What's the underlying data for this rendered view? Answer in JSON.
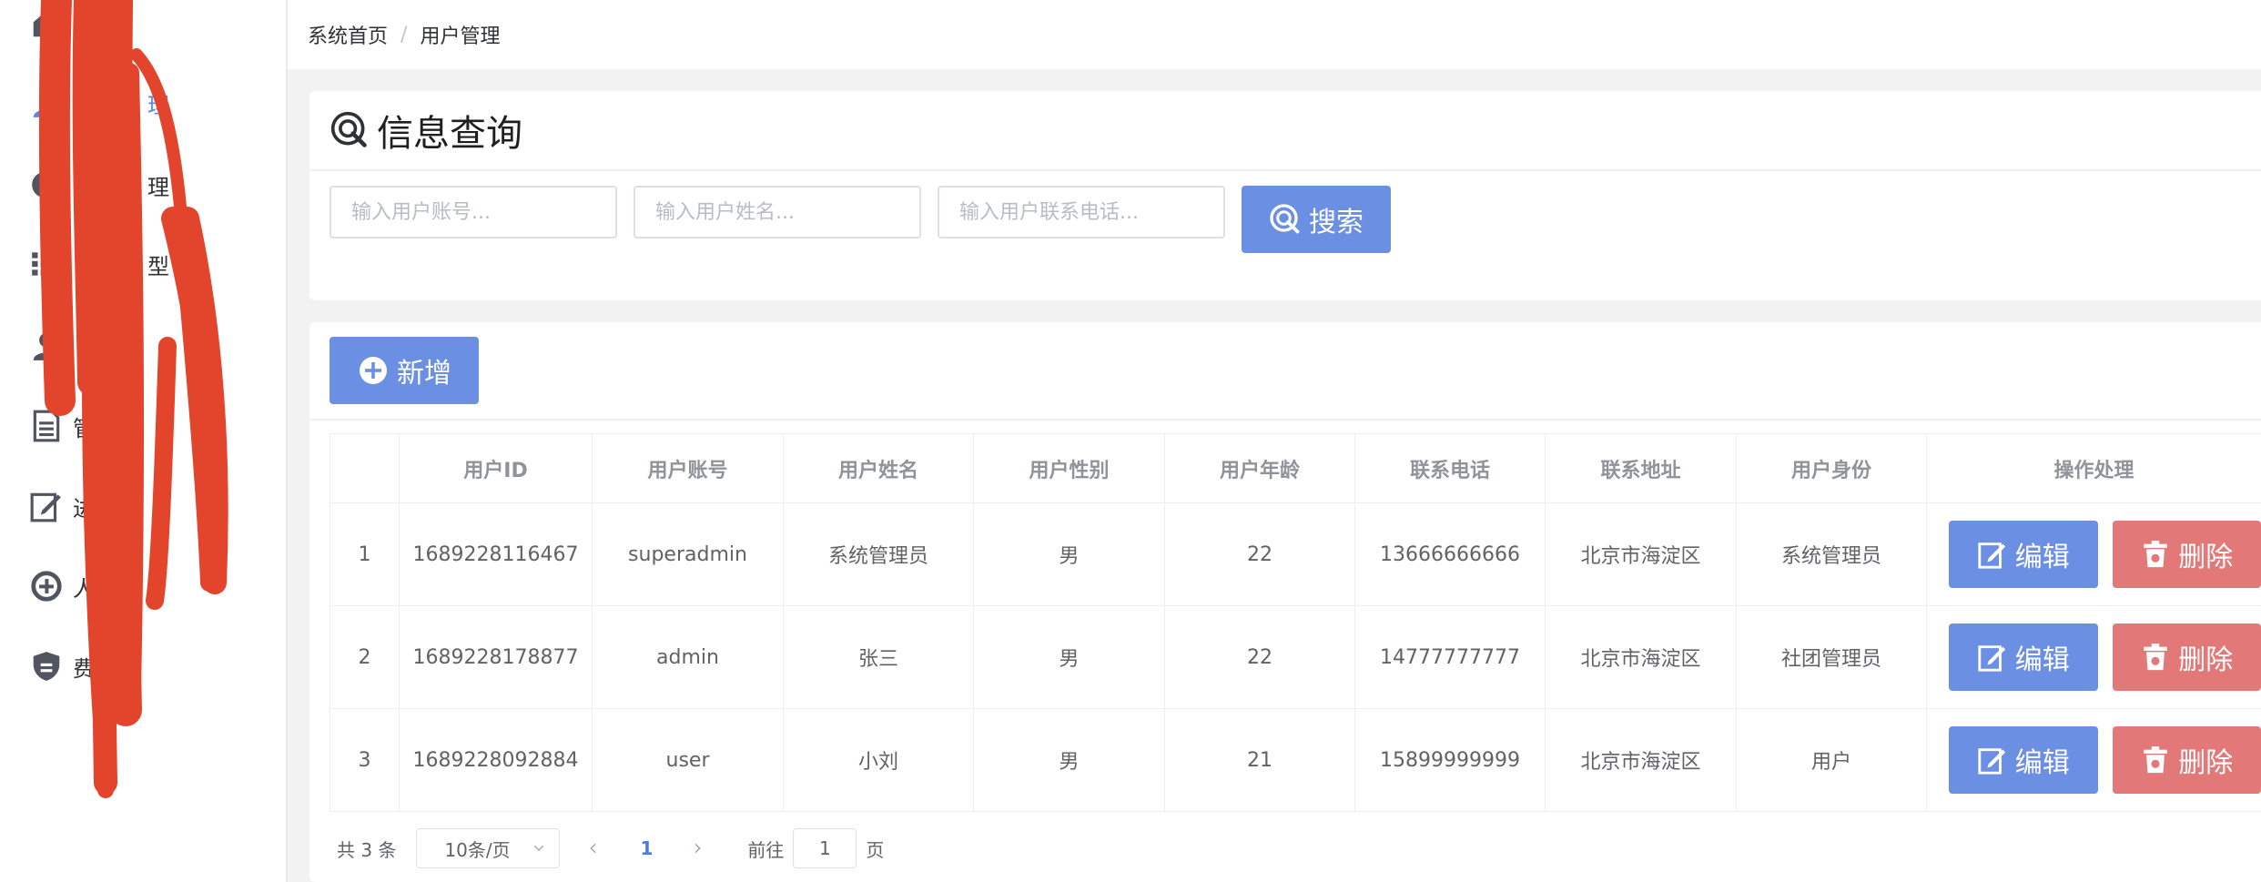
{
  "sidebar": {
    "items": [
      {
        "label": "",
        "icon": "home-icon"
      },
      {
        "label": "理",
        "icon": "user-icon"
      },
      {
        "label": "理",
        "icon": "pie-chart-icon"
      },
      {
        "label": "型",
        "icon": "list-icon"
      },
      {
        "label": "",
        "icon": "user-icon"
      },
      {
        "label": "管",
        "icon": "document-icon"
      },
      {
        "label": "进",
        "icon": "edit-icon"
      },
      {
        "label": "人",
        "icon": "add-circle-icon"
      },
      {
        "label": "费理",
        "icon": "shield-icon"
      }
    ],
    "active_color": "#5b86e5"
  },
  "breadcrumb": {
    "home": "系统首页",
    "separator": "/",
    "current": "用户管理"
  },
  "search": {
    "title": "信息查询",
    "account_placeholder": "输入用户账号...",
    "name_placeholder": "输入用户姓名...",
    "phone_placeholder": "输入用户联系电话...",
    "search_label": "搜索"
  },
  "toolbar": {
    "add_label": "新增"
  },
  "table": {
    "columns": [
      "",
      "用户ID",
      "用户账号",
      "用户姓名",
      "用户性别",
      "用户年龄",
      "联系电话",
      "联系地址",
      "用户身份",
      "操作处理"
    ],
    "rows": [
      {
        "index": "1",
        "id": "1689228116467",
        "account": "superadmin",
        "name": "系统管理员",
        "gender": "男",
        "age": "22",
        "phone": "13666666666",
        "address": "北京市海淀区",
        "role": "系统管理员"
      },
      {
        "index": "2",
        "id": "1689228178877",
        "account": "admin",
        "name": "张三",
        "gender": "男",
        "age": "22",
        "phone": "14777777777",
        "address": "北京市海淀区",
        "role": "社团管理员"
      },
      {
        "index": "3",
        "id": "1689228092884",
        "account": "user",
        "name": "小刘",
        "gender": "男",
        "age": "21",
        "phone": "15899999999",
        "address": "北京市海淀区",
        "role": "用户"
      }
    ],
    "edit_label": "编辑",
    "delete_label": "删除"
  },
  "pagination": {
    "total": "共 3 条",
    "page_size": "10条/页",
    "current_page": "1",
    "goto_prefix": "前往",
    "goto_value": "1",
    "goto_suffix": "页"
  },
  "colors": {
    "primary": "#6b8fe3",
    "danger": "#e27878",
    "active_page": "#4a7ce0",
    "redaction": "#e2452c"
  }
}
